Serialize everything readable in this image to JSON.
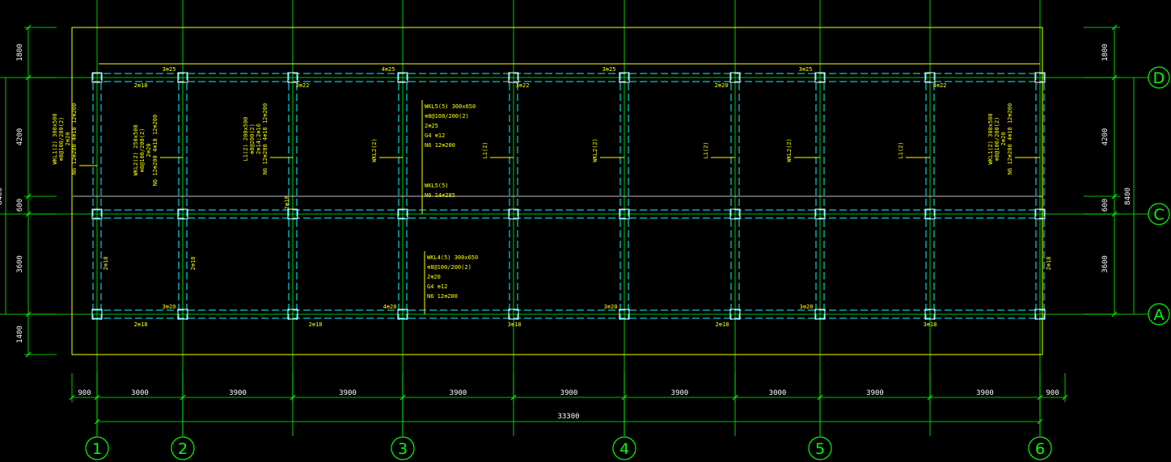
{
  "colors": {
    "background": "#000000",
    "grid": "#00ff00",
    "slab_outline": "#ffff00",
    "beam_dash": "#00ffff",
    "beam_solid": "#ffffff",
    "dim_text": "#ffffff",
    "annotation": "#ffff00"
  },
  "axes": {
    "vertical": [
      "1",
      "2",
      "3",
      "4",
      "5",
      "6"
    ],
    "horizontal": [
      "D",
      "C",
      "A"
    ]
  },
  "dimensions": {
    "bottom_spans": [
      "900",
      "3000",
      "3900",
      "3900",
      "3900",
      "3900",
      "3900",
      "3000",
      "3900",
      "3900",
      "900"
    ],
    "bottom_total": "33300",
    "left_spans": [
      "1800",
      "4200",
      "600",
      "3600",
      "1400"
    ],
    "left_partial": "8400",
    "right_spans": [
      "1800",
      "4200",
      "600",
      "3600"
    ],
    "right_total": "8400"
  },
  "top_reinforcement": [
    "3⊕25",
    "4⊕25",
    "3⊕25",
    "3⊕25"
  ],
  "top_bay_labels": [
    "2⊕18",
    "3⊕22",
    "3⊕22",
    "2⊕20",
    "4⊕22"
  ],
  "bottom_reinforcement": [
    "2⊕18",
    "2⊕18",
    "3⊕18",
    "2⊕18",
    "3⊕18"
  ],
  "bottom_bay_labels": [
    "3⊕20",
    "4⊕20",
    "3⊕20",
    "3⊕20"
  ],
  "side_labels": [
    "2⊕18",
    "2⊕18",
    "2⊕18",
    "2⊕18"
  ],
  "vertical_annotations": [
    [
      "WKL1(2) 300x500",
      "⊕8@100/200(2)",
      "2⊕20",
      "N6 12⊕200 4⊕18 12⊕200"
    ],
    [
      "WKL2(2) 250x500",
      "⊕8@100/200(2)",
      "2⊕20",
      "N6 12⊕200 4⊕18 12⊕200"
    ],
    [
      "L1(2) 200x500",
      "⊕8@200(2)",
      "2⊕14;2⊕16",
      "N6 12⊕200 4⊕18 12⊕200"
    ],
    [
      "WKL2(2)"
    ],
    [
      "L1(2)"
    ],
    [
      "WKL2(2)"
    ],
    [
      "L1(2)"
    ],
    [
      "WKL2(2)"
    ],
    [
      "L1(2)"
    ],
    [
      "WKL1(2) 300x500",
      "⊕8@100/200(2)",
      "2⊕20",
      "N6 12⊕200 4⊕18 12⊕200"
    ]
  ],
  "beam_callouts": {
    "upper": [
      "WKL5(5) 300x650",
      "⊕8@100/200(2)",
      "2⊕25",
      "G4 ⊕12",
      "N6 12⊕200"
    ],
    "middle": [
      "WKL5(5)",
      "N6 14⊕285"
    ],
    "lower": [
      "WKL4(5) 300x650",
      "⊕8@100/200(2)",
      "2⊕20",
      "G4 ⊕12",
      "N6 12⊕200"
    ]
  }
}
